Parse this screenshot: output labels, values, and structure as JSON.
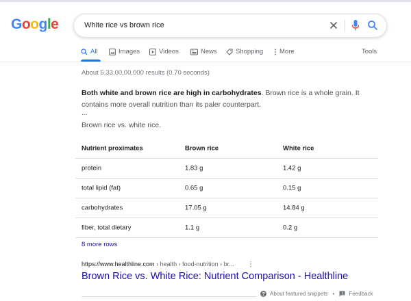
{
  "logo": {
    "letters": [
      "G",
      "o",
      "o",
      "g",
      "l",
      "e"
    ],
    "colors": [
      "#4285F4",
      "#EA4335",
      "#FBBC05",
      "#4285F4",
      "#34A853",
      "#EA4335"
    ]
  },
  "search": {
    "query": "White rice vs brown rice"
  },
  "tabs": [
    {
      "label": "All",
      "icon": "search-icon"
    },
    {
      "label": "Images",
      "icon": "image-icon"
    },
    {
      "label": "Videos",
      "icon": "video-icon"
    },
    {
      "label": "News",
      "icon": "news-icon"
    },
    {
      "label": "Shopping",
      "icon": "tag-icon"
    },
    {
      "label": "More",
      "icon": "kebab-icon"
    }
  ],
  "tools_label": "Tools",
  "result_stats": "About 5,33,00,00,000 results (0.70 seconds)",
  "snippet": {
    "bold": "Both white and brown rice are high in carbohydrates",
    "rest": ". Brown rice is a whole grain. It contains more overall nutrition than its paler counterpart.",
    "ellipsis": "...",
    "subheading": "Brown rice vs. white rice."
  },
  "table": {
    "headers": [
      "Nutrient proximates",
      "Brown rice",
      "White rice"
    ],
    "rows": [
      [
        "protein",
        "1.83 g",
        "1.42 g"
      ],
      [
        "total lipid (fat)",
        "0.65 g",
        "0.15 g"
      ],
      [
        "carbohydrates",
        "17.05 g",
        "14.84 g"
      ],
      [
        "fiber, total dietary",
        "1.1 g",
        "0.2 g"
      ]
    ]
  },
  "more_rows": "8 more rows",
  "result": {
    "domain": "https://www.healthline.com",
    "path": " › health › food-nutrition › br...",
    "title": "Brown Rice vs. White Rice: Nutrient Comparison - Healthline"
  },
  "footer": {
    "about": "About featured snippets",
    "separator": "•",
    "feedback": "Feedback"
  },
  "colors": {
    "link": "#1a0dab",
    "accent": "#1a73e8",
    "mic_blue": "#4285F4",
    "mic_red": "#EA4335"
  }
}
